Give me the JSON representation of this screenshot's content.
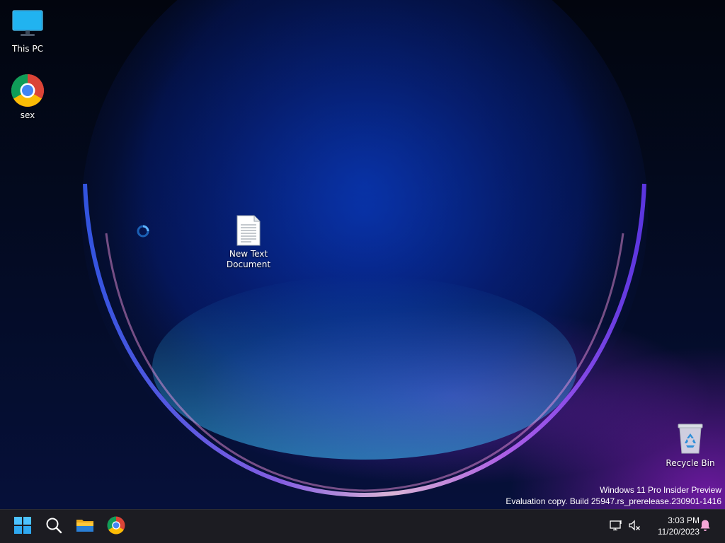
{
  "desktop": {
    "icons": [
      {
        "label": "This PC",
        "icon": "this-pc-icon"
      },
      {
        "label": "sex",
        "icon": "chrome-icon"
      },
      {
        "label": "New Text Document",
        "icon": "text-document-icon"
      },
      {
        "label": "Recycle Bin",
        "icon": "recycle-bin-icon"
      }
    ],
    "watermark": {
      "line1": "Windows 11 Pro Insider Preview",
      "line2": "Evaluation copy. Build 25947.rs_prerelease.230901-1416"
    }
  },
  "taskbar": {
    "buttons": [
      {
        "name": "Start",
        "icon": "windows-start-icon"
      },
      {
        "name": "Search",
        "icon": "search-icon"
      },
      {
        "name": "File Explorer",
        "icon": "folder-icon"
      },
      {
        "name": "Google Chrome",
        "icon": "chrome-icon"
      }
    ],
    "tray": {
      "network": "network-icon",
      "volume": "volume-muted-icon",
      "notifications": "bell-icon"
    },
    "clock": {
      "time": "3:03 PM",
      "date": "11/20/2023"
    }
  },
  "colors": {
    "taskbar": "#1c1c22",
    "accent": "#0078d4",
    "notification_bell": "#f4a6d7"
  }
}
